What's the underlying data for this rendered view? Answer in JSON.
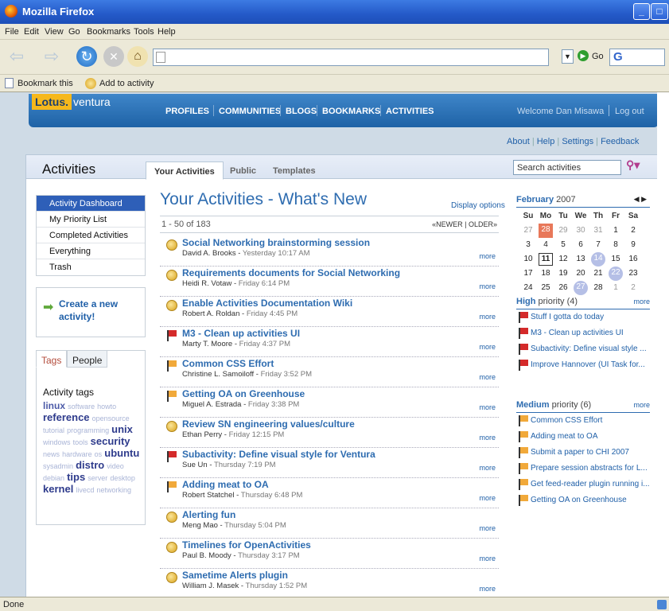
{
  "window": {
    "title": "Mozilla Firefox"
  },
  "menu": [
    "File",
    "Edit",
    "View",
    "Go",
    "Bookmarks",
    "Tools",
    "Help"
  ],
  "nav": {
    "go_label": "Go",
    "search_logo": "G"
  },
  "bookmarks": {
    "bookmark_this": "Bookmark this",
    "add_to_activity": "Add to activity"
  },
  "banner": {
    "logo_lotus": "Lotus.",
    "logo_product": "ventura",
    "nav_items": [
      "PROFILES",
      "COMMUNITIES",
      "BLOGS",
      "BOOKMARKS",
      "ACTIVITIES"
    ],
    "welcome": "Welcome Dan Misawa",
    "logout": "Log out"
  },
  "toplinks": [
    "About",
    "Help",
    "Settings",
    "Feedback"
  ],
  "page": {
    "title": "Activities",
    "tabs": [
      "Your Activities",
      "Public",
      "Templates"
    ],
    "search_placeholder": "Search activities"
  },
  "sidenav": [
    "Activity Dashboard",
    "My Priority List",
    "Completed Activities",
    "Everything",
    "Trash"
  ],
  "create": {
    "label": "Create a new activity!"
  },
  "tags": {
    "tabs": [
      "Tags",
      "People"
    ],
    "heading": "Activity tags",
    "cloud": [
      {
        "t": "linux",
        "w": 2
      },
      {
        "t": "software",
        "w": 1
      },
      {
        "t": "howto",
        "w": 1
      },
      {
        "t": "reference",
        "w": 3
      },
      {
        "t": "opensource",
        "w": 1
      },
      {
        "t": "tutorial",
        "w": 1
      },
      {
        "t": "programming",
        "w": 1
      },
      {
        "t": "unix",
        "w": 3
      },
      {
        "t": "windows",
        "w": 1
      },
      {
        "t": "tools",
        "w": 1
      },
      {
        "t": "security",
        "w": 3
      },
      {
        "t": "news",
        "w": 1
      },
      {
        "t": "hardware",
        "w": 1
      },
      {
        "t": "os",
        "w": 1
      },
      {
        "t": "ubuntu",
        "w": 3
      },
      {
        "t": "sysadmin",
        "w": 1
      },
      {
        "t": "distro",
        "w": 3
      },
      {
        "t": "video",
        "w": 1
      },
      {
        "t": "debian",
        "w": 1
      },
      {
        "t": "tips",
        "w": 3
      },
      {
        "t": "server",
        "w": 1
      },
      {
        "t": "desktop",
        "w": 1
      },
      {
        "t": "kernel",
        "w": 3
      },
      {
        "t": "livecd",
        "w": 1
      },
      {
        "t": "networking",
        "w": 1
      }
    ]
  },
  "activities": {
    "heading": "Your Activities - What's New",
    "display_options": "Display options",
    "count": "1 - 50 of 183",
    "newer": "«NEWER",
    "older": "OLDER»",
    "more_label": "more",
    "items": [
      {
        "title": "Social Networking brainstorming session",
        "author": "David A. Brooks",
        "date": "Yesterday 10:17 AM",
        "icon": "star"
      },
      {
        "title": "Requirements documents for Social Networking",
        "author": "Heidi R. Votaw",
        "date": "Friday 6:14 PM",
        "icon": "star"
      },
      {
        "title": "Enable Activities Documentation Wiki",
        "author": "Robert A. Roldan",
        "date": "Friday 4:45 PM",
        "icon": "star"
      },
      {
        "title": "M3 - Clean up activities UI",
        "author": "Marty T. Moore",
        "date": "Friday 4:37 PM",
        "icon": "red-flag"
      },
      {
        "title": "Common CSS Effort",
        "author": "Christine L. Samoiloff",
        "date": "Friday 3:52 PM",
        "icon": "orange-flag"
      },
      {
        "title": "Getting OA on Greenhouse",
        "author": "Miguel A. Estrada",
        "date": "Friday 3:38 PM",
        "icon": "orange-flag"
      },
      {
        "title": "Review SN engineering values/culture",
        "author": "Ethan Perry",
        "date": "Friday 12:15 PM",
        "icon": "star"
      },
      {
        "title": "Subactivity: Define visual style for Ventura",
        "author": "Sue Un",
        "date": "Thursday 7:19 PM",
        "icon": "red-flag"
      },
      {
        "title": "Adding meat to OA",
        "author": "Robert Statchel",
        "date": "Thursday 6:48 PM",
        "icon": "orange-flag"
      },
      {
        "title": "Alerting fun",
        "author": "Meng Mao",
        "date": "Thursday 5:04 PM",
        "icon": "star"
      },
      {
        "title": "Timelines for OpenActivities",
        "author": "Paul B. Moody",
        "date": "Thursday 3:17 PM",
        "icon": "star"
      },
      {
        "title": "Sametime Alerts plugin",
        "author": "William J. Masek",
        "date": "Thursday 1:52 PM",
        "icon": "star"
      }
    ]
  },
  "calendar": {
    "month": "February",
    "year": "2007",
    "weekdays": [
      "Su",
      "Mo",
      "Tu",
      "We",
      "Th",
      "Fr",
      "Sa"
    ],
    "weeks": [
      [
        "27",
        "28",
        "29",
        "30",
        "31",
        "1",
        "2"
      ],
      [
        "3",
        "4",
        "5",
        "6",
        "7",
        "8",
        "9"
      ],
      [
        "10",
        "11",
        "12",
        "13",
        "14",
        "15",
        "16"
      ],
      [
        "17",
        "18",
        "19",
        "20",
        "21",
        "22",
        "23"
      ],
      [
        "24",
        "25",
        "26",
        "27",
        "28",
        "1",
        "2"
      ]
    ]
  },
  "high_priority": {
    "level": "High",
    "label": "priority (4)",
    "more": "more",
    "items": [
      "Stuff I gotta do today",
      "M3 - Clean up activities UI",
      "Subactivity: Define visual style ...",
      "Improve Hannover (UI Task for..."
    ]
  },
  "medium_priority": {
    "level": "Medium",
    "label": "priority (6)",
    "more": "more",
    "items": [
      "Common CSS Effort",
      "Adding meat to OA",
      "Submit a paper to CHI 2007",
      "Prepare session abstracts for L...",
      "Get feed-reader plugin running i...",
      "Getting OA on Greenhouse"
    ]
  },
  "colors": {
    "red_flag": "#d42a2a",
    "orange_flag": "#f1a93a",
    "accent": "#2e6cb0"
  },
  "status": {
    "text": "Done"
  }
}
